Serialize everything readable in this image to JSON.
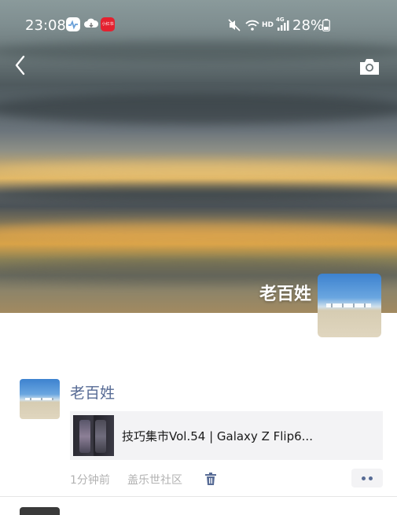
{
  "status_bar": {
    "time": "23:08",
    "battery": "28%",
    "network_label": "HD",
    "signal_type": "4G",
    "app_badge_text": "小红书"
  },
  "cover": {
    "owner_name": "老百姓"
  },
  "post": {
    "author": "老百姓",
    "shared_link_title": "技巧集市Vol.54 | Galaxy Z Flip6...",
    "time_ago": "1分钟前",
    "source": "盖乐世社区"
  },
  "colors": {
    "link_blue": "#576b95",
    "meta_gray": "#b2b2b2",
    "card_bg": "#f3f3f5"
  },
  "icons": {
    "back": "back-chevron-icon",
    "camera": "camera-icon",
    "delete": "trash-icon",
    "more": "more-dots-icon"
  }
}
